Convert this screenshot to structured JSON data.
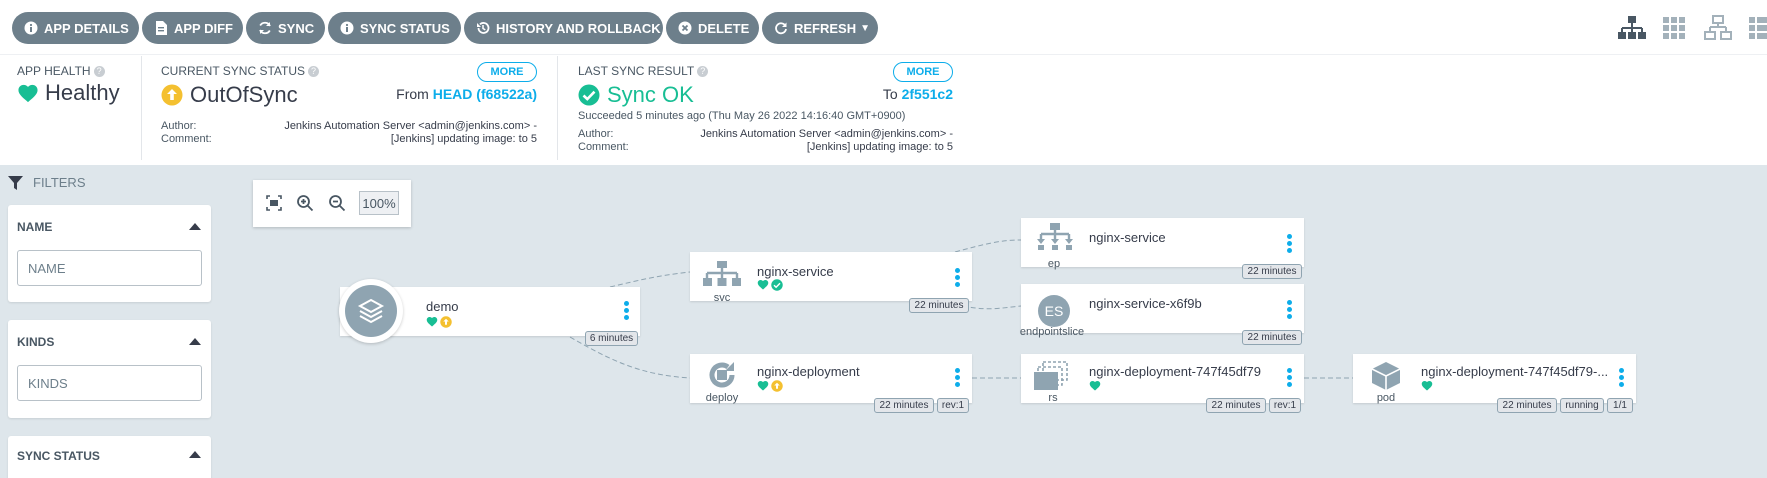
{
  "toolbar": {
    "buttons": [
      {
        "label": "APP DETAILS",
        "icon": "info-icon"
      },
      {
        "label": "APP DIFF",
        "icon": "file-icon"
      },
      {
        "label": "SYNC",
        "icon": "sync-icon"
      },
      {
        "label": "SYNC STATUS",
        "icon": "info-icon"
      },
      {
        "label": "HISTORY AND ROLLBACK",
        "icon": "history-icon"
      },
      {
        "label": "DELETE",
        "icon": "delete-icon"
      },
      {
        "label": "REFRESH",
        "icon": "refresh-icon"
      }
    ],
    "views": [
      "tree-view-icon",
      "pods-view-icon",
      "network-view-icon",
      "list-view-icon"
    ]
  },
  "status": {
    "app_health": {
      "title": "APP HEALTH",
      "value": "Healthy"
    },
    "current_sync": {
      "title": "CURRENT SYNC STATUS",
      "value": "OutOfSync",
      "more": "MORE",
      "from_label": "From",
      "from_ref": "HEAD (f68522a)",
      "author_label": "Author:",
      "author_value": "Jenkins Automation Server <admin@jenkins.com> -",
      "comment_label": "Comment:",
      "comment_value": "[Jenkins] updating image: to 5"
    },
    "last_sync": {
      "title": "LAST SYNC RESULT",
      "value": "Sync OK",
      "more": "MORE",
      "to_label": "To",
      "to_ref": "2f551c2",
      "succeeded": "Succeeded 5 minutes ago (Thu May 26 2022 14:16:40 GMT+0900)",
      "author_label": "Author:",
      "author_value": "Jenkins Automation Server <admin@jenkins.com> -",
      "comment_label": "Comment:",
      "comment_value": "[Jenkins] updating image: to 5"
    },
    "colors": {
      "healthy": "#18be94",
      "outofsync": "#f4c030",
      "accent": "#0dadea",
      "button": "#6d7f8b"
    }
  },
  "filters": {
    "heading": "FILTERS",
    "name": {
      "title": "NAME",
      "placeholder": "NAME"
    },
    "kinds": {
      "title": "KINDS",
      "placeholder": "KINDS"
    },
    "sync_status": {
      "title": "SYNC STATUS"
    }
  },
  "zoom": {
    "level": "100%"
  },
  "nodes": {
    "demo": {
      "name": "demo",
      "age": "6 minutes"
    },
    "svc": {
      "name": "nginx-service",
      "kind": "svc",
      "age": "22 minutes"
    },
    "deploy": {
      "name": "nginx-deployment",
      "kind": "deploy",
      "age": "22 minutes",
      "rev": "rev:1"
    },
    "ep": {
      "name": "nginx-service",
      "kind": "ep",
      "age": "22 minutes"
    },
    "eps": {
      "name": "nginx-service-x6f9b",
      "kind": "endpointslice",
      "badge": "ES",
      "age": "22 minutes"
    },
    "rs": {
      "name": "nginx-deployment-747f45df79",
      "kind": "rs",
      "age": "22 minutes",
      "rev": "rev:1"
    },
    "pod": {
      "name": "nginx-deployment-747f45df79-...",
      "kind": "pod",
      "age": "22 minutes",
      "state": "running",
      "count": "1/1"
    }
  }
}
